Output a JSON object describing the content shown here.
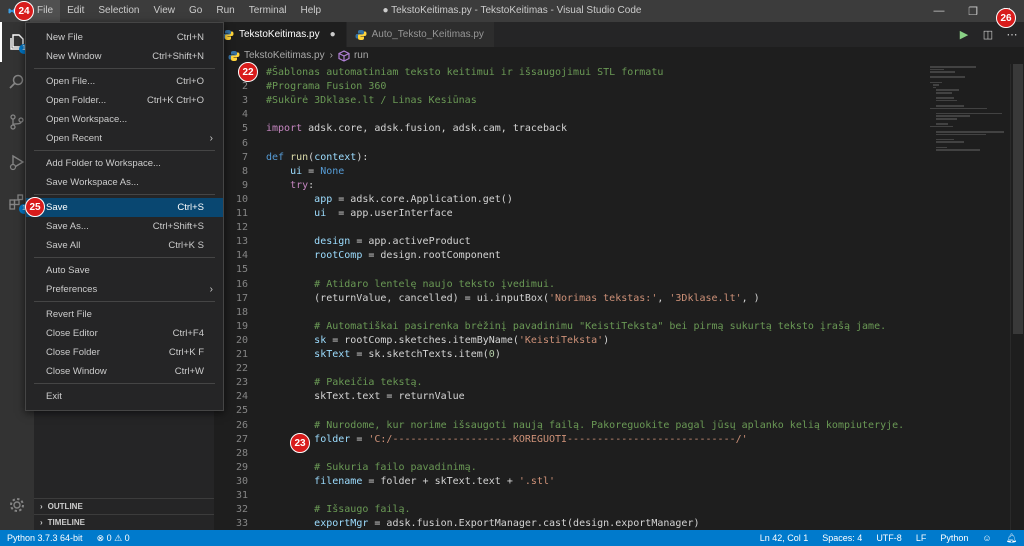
{
  "menubar": [
    "File",
    "Edit",
    "Selection",
    "View",
    "Go",
    "Run",
    "Terminal",
    "Help"
  ],
  "window_title": "● TekstoKeitimas.py - TekstoKeitimas - Visual Studio Code",
  "tabs": [
    {
      "label": "TekstoKeitimas.py",
      "active": true
    },
    {
      "label": "Auto_Teksto_Keitimas.py",
      "active": false
    }
  ],
  "breadcrumb": {
    "file": "TekstoKeitimas.py",
    "symbol": "run"
  },
  "activity_badges": {
    "explorer": "1",
    "extensions": "1"
  },
  "sidebar_sections": [
    "OUTLINE",
    "TIMELINE"
  ],
  "file_menu": [
    {
      "label": "New File",
      "key": "Ctrl+N"
    },
    {
      "label": "New Window",
      "key": "Ctrl+Shift+N"
    },
    {
      "sep": true
    },
    {
      "label": "Open File...",
      "key": "Ctrl+O"
    },
    {
      "label": "Open Folder...",
      "key": "Ctrl+K Ctrl+O"
    },
    {
      "label": "Open Workspace...",
      "key": ""
    },
    {
      "label": "Open Recent",
      "key": "",
      "submenu": true
    },
    {
      "sep": true
    },
    {
      "label": "Add Folder to Workspace...",
      "key": ""
    },
    {
      "label": "Save Workspace As...",
      "key": ""
    },
    {
      "sep": true
    },
    {
      "label": "Save",
      "key": "Ctrl+S",
      "highlight": true
    },
    {
      "label": "Save As...",
      "key": "Ctrl+Shift+S"
    },
    {
      "label": "Save All",
      "key": "Ctrl+K S"
    },
    {
      "sep": true
    },
    {
      "label": "Auto Save",
      "key": ""
    },
    {
      "label": "Preferences",
      "key": "",
      "submenu": true
    },
    {
      "sep": true
    },
    {
      "label": "Revert File",
      "key": ""
    },
    {
      "label": "Close Editor",
      "key": "Ctrl+F4"
    },
    {
      "label": "Close Folder",
      "key": "Ctrl+K F"
    },
    {
      "label": "Close Window",
      "key": "Ctrl+W"
    },
    {
      "sep": true
    },
    {
      "label": "Exit",
      "key": ""
    }
  ],
  "code_lines": [
    {
      "n": "1",
      "segs": [
        [
          "c-comment",
          "#Šablonas automatiniam teksto keitimui ir išsaugojimui STL formatu"
        ]
      ]
    },
    {
      "n": "2",
      "segs": [
        [
          "c-comment",
          "#Programa Fusion 360"
        ]
      ]
    },
    {
      "n": "3",
      "segs": [
        [
          "c-comment",
          "#Sukūrė 3Dklase.lt / Linas Kesiūnas"
        ]
      ]
    },
    {
      "n": "4",
      "segs": []
    },
    {
      "n": "5",
      "segs": [
        [
          "c-ctrl",
          "import"
        ],
        [
          "",
          " adsk.core, adsk.fusion, adsk.cam, traceback"
        ]
      ]
    },
    {
      "n": "6",
      "segs": []
    },
    {
      "n": "7",
      "segs": [
        [
          "c-kw",
          "def"
        ],
        [
          "",
          " "
        ],
        [
          "c-fn",
          "run"
        ],
        [
          "",
          "("
        ],
        [
          "c-var",
          "context"
        ],
        [
          "",
          "):"
        ]
      ]
    },
    {
      "n": "8",
      "segs": [
        [
          "",
          "    "
        ],
        [
          "c-var",
          "ui"
        ],
        [
          "",
          " = "
        ],
        [
          "c-kw",
          "None"
        ]
      ]
    },
    {
      "n": "9",
      "segs": [
        [
          "",
          "    "
        ],
        [
          "c-ctrl",
          "try"
        ],
        [
          "",
          ":"
        ]
      ]
    },
    {
      "n": "10",
      "segs": [
        [
          "",
          "        "
        ],
        [
          "c-var",
          "app"
        ],
        [
          "",
          " = adsk.core.Application.get()"
        ]
      ]
    },
    {
      "n": "11",
      "segs": [
        [
          "",
          "        "
        ],
        [
          "c-var",
          "ui"
        ],
        [
          "",
          "  = app.userInterface"
        ]
      ]
    },
    {
      "n": "12",
      "segs": []
    },
    {
      "n": "13",
      "segs": [
        [
          "",
          "        "
        ],
        [
          "c-var",
          "design"
        ],
        [
          "",
          " = app.activeProduct"
        ]
      ]
    },
    {
      "n": "14",
      "segs": [
        [
          "",
          "        "
        ],
        [
          "c-var",
          "rootComp"
        ],
        [
          "",
          " = design.rootComponent"
        ]
      ]
    },
    {
      "n": "15",
      "segs": []
    },
    {
      "n": "16",
      "segs": [
        [
          "",
          "        "
        ],
        [
          "c-comment",
          "# Atidaro lentelę naujo teksto įvedimui."
        ]
      ]
    },
    {
      "n": "17",
      "segs": [
        [
          "",
          "        (returnValue, cancelled) = ui.inputBox("
        ],
        [
          "c-str",
          "'Norimas tekstas:'"
        ],
        [
          "",
          ", "
        ],
        [
          "c-str",
          "'3Dklase.lt'"
        ],
        [
          "",
          ", )"
        ]
      ]
    },
    {
      "n": "18",
      "segs": []
    },
    {
      "n": "19",
      "segs": [
        [
          "",
          "        "
        ],
        [
          "c-comment",
          "# Automatiškai pasirenka brėžinį pavadinimu \"KeistiTeksta\" bei pirmą sukurtą teksto įrašą jame."
        ]
      ]
    },
    {
      "n": "20",
      "segs": [
        [
          "",
          "        "
        ],
        [
          "c-var",
          "sk"
        ],
        [
          "",
          " = rootComp.sketches.itemByName("
        ],
        [
          "c-str",
          "'KeistiTeksta'"
        ],
        [
          "",
          ")"
        ]
      ]
    },
    {
      "n": "21",
      "segs": [
        [
          "",
          "        "
        ],
        [
          "c-var",
          "skText"
        ],
        [
          "",
          " = sk.sketchTexts.item("
        ],
        [
          "c-num",
          "0"
        ],
        [
          "",
          ")"
        ]
      ]
    },
    {
      "n": "22",
      "segs": []
    },
    {
      "n": "23",
      "segs": [
        [
          "",
          "        "
        ],
        [
          "c-comment",
          "# Pakeičia tekstą."
        ]
      ]
    },
    {
      "n": "24",
      "segs": [
        [
          "",
          "        skText.text = returnValue"
        ]
      ]
    },
    {
      "n": "25",
      "segs": []
    },
    {
      "n": "26",
      "segs": [
        [
          "",
          "        "
        ],
        [
          "c-comment",
          "# Nurodome, kur norime išsaugoti naują failą. Pakoreguokite pagal jūsų aplanko kelią kompiuteryje."
        ]
      ]
    },
    {
      "n": "27",
      "segs": [
        [
          "",
          "        "
        ],
        [
          "c-var",
          "folder"
        ],
        [
          "",
          " = "
        ],
        [
          "c-str",
          "'C:/--------------------KOREGUOTI----------------------------/'"
        ]
      ]
    },
    {
      "n": "28",
      "segs": []
    },
    {
      "n": "29",
      "segs": [
        [
          "",
          "        "
        ],
        [
          "c-comment",
          "# Sukuria failo pavadinimą."
        ]
      ]
    },
    {
      "n": "30",
      "segs": [
        [
          "",
          "        "
        ],
        [
          "c-var",
          "filename"
        ],
        [
          "",
          " = folder + skText.text + "
        ],
        [
          "c-str",
          "'.stl'"
        ]
      ]
    },
    {
      "n": "31",
      "segs": []
    },
    {
      "n": "32",
      "segs": [
        [
          "",
          "        "
        ],
        [
          "c-comment",
          "# Išsaugo failą."
        ]
      ]
    },
    {
      "n": "33",
      "segs": [
        [
          "",
          "        "
        ],
        [
          "c-var",
          "exportMgr"
        ],
        [
          "",
          " = adsk.fusion.ExportManager.cast(design.exportManager)"
        ]
      ]
    }
  ],
  "status": {
    "python": "Python 3.7.3 64-bit",
    "problems": "⊗ 0 ⚠ 0",
    "position": "Ln 42, Col 1",
    "spaces": "Spaces: 4",
    "encoding": "UTF-8",
    "eol": "LF",
    "language": "Python"
  },
  "markers": [
    "24",
    "25",
    "22",
    "23",
    "26"
  ],
  "colors": {
    "accent": "#007acc",
    "highlight": "#094771",
    "marker": "#d81b1b"
  }
}
